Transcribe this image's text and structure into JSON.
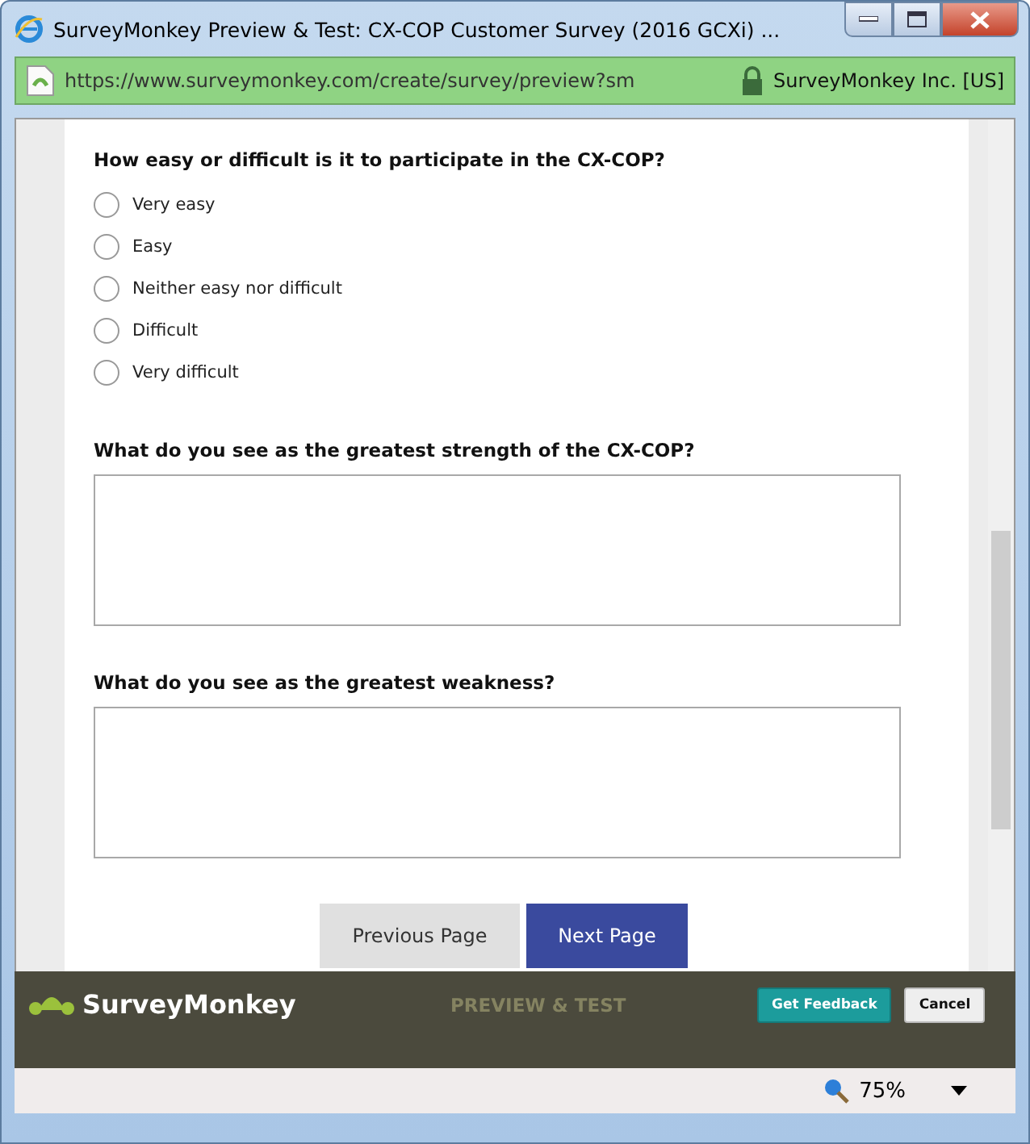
{
  "window": {
    "title": "SurveyMonkey Preview & Test: CX-COP Customer Survey (2016 GCXi) ..."
  },
  "address_bar": {
    "url": "https://www.surveymonkey.com/create/survey/preview?sm",
    "certificate": "SurveyMonkey Inc. [US]"
  },
  "questions": [
    {
      "kind": "choice",
      "text": "How easy or difficult is it to participate in the CX-COP?",
      "options": [
        {
          "label": "Very easy",
          "selected": false
        },
        {
          "label": "Easy",
          "selected": false
        },
        {
          "label": "Neither easy nor difficult",
          "selected": false
        },
        {
          "label": "Difficult",
          "selected": false
        },
        {
          "label": "Very difficult",
          "selected": false
        }
      ]
    },
    {
      "kind": "text",
      "text": "What do you see as the greatest strength of the CX-COP?"
    },
    {
      "kind": "text",
      "text": "What do you see as the greatest weakness?"
    }
  ],
  "nav_buttons": [
    {
      "label": "Previous Page",
      "kind": "secondary"
    },
    {
      "label": "Next Page",
      "kind": "primary"
    }
  ],
  "footer": {
    "brand": "SurveyMonkey",
    "mode": "PREVIEW & TEST",
    "buttons": [
      {
        "label": "Get Feedback",
        "kind": "primary"
      },
      {
        "label": "Cancel",
        "kind": "secondary"
      }
    ]
  },
  "status_bar": {
    "zoom": "75%"
  }
}
